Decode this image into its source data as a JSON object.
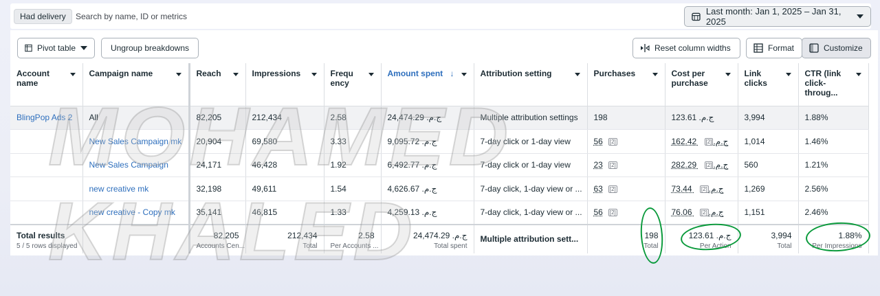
{
  "toolbar_top": {
    "filter_chip": "Had delivery",
    "search_placeholder": "Search by name, ID or metrics",
    "date_range": "Last month: Jan 1, 2025 – Jan 31, 2025"
  },
  "toolbar": {
    "pivot": "Pivot table",
    "ungroup": "Ungroup breakdowns",
    "reset": "Reset column widths",
    "format": "Format",
    "customize": "Customize"
  },
  "columns": [
    "Account name",
    "Campaign name",
    "Reach",
    "Impressions",
    "Frequ ency",
    "Amount spent",
    "Attribution setting",
    "Purchases",
    "Cost per purchase",
    "Link clicks",
    "CTR (link click-throug..."
  ],
  "rows": [
    {
      "account": "BlingPop Ads 2",
      "campaign": "All",
      "reach": "82,205",
      "impressions": "212,434",
      "frequency": "2.58",
      "spent": "24,474.29 ج.م.‏",
      "attribution": "Multiple attribution settings",
      "purchases": "198",
      "cost": "123.61 ج.م.‏",
      "clicks": "3,994",
      "ctr": "1.88%"
    },
    {
      "account": "",
      "campaign": "New Sales Campaign mk",
      "reach": "20,904",
      "impressions": "69,580",
      "frequency": "3.33",
      "spent": "9,095.72 ج.م.‏",
      "attribution": "7-day click or 1-day view",
      "purchases": "56",
      "cost": "162.42 ج.م.‏",
      "clicks": "1,014",
      "ctr": "1.46%"
    },
    {
      "account": "",
      "campaign": "New Sales Campaign",
      "reach": "24,171",
      "impressions": "46,428",
      "frequency": "1.92",
      "spent": "6,492.77 ج.م.‏",
      "attribution": "7-day click or 1-day view",
      "purchases": "23",
      "cost": "282.29 ج.م.‏",
      "clicks": "560",
      "ctr": "1.21%"
    },
    {
      "account": "",
      "campaign": "new creative mk",
      "reach": "32,198",
      "impressions": "49,611",
      "frequency": "1.54",
      "spent": "4,626.67 ج.م.‏",
      "attribution": "7-day click, 1-day view or ...",
      "purchases": "63",
      "cost": "73.44 ج.م.‏",
      "clicks": "1,269",
      "ctr": "2.56%"
    },
    {
      "account": "",
      "campaign": "new creative - Copy mk",
      "reach": "35,141",
      "impressions": "46,815",
      "frequency": "1.33",
      "spent": "4,259.13 ج.م.‏",
      "attribution": "7-day click, 1-day view or ...",
      "purchases": "56",
      "cost": "76.06 ج.م.‏",
      "clicks": "1,151",
      "ctr": "2.46%"
    }
  ],
  "sup_label": "[2]",
  "totals": {
    "label": "Total results",
    "sublabel": "5 / 5 rows displayed",
    "reach": "82,205",
    "reach_sub": "Accounts Cen...",
    "impressions": "212,434",
    "impressions_sub": "Total",
    "frequency": "2.58",
    "frequency_sub": "Per Accounts ...",
    "spent": "24,474.29 ج.م.‏",
    "spent_sub": "Total spent",
    "attribution": "Multiple attribution sett...",
    "purchases": "198",
    "purchases_sub": "Total",
    "cost": "123.61 ج.م.‏",
    "cost_sub": "Per Action",
    "clicks": "3,994",
    "clicks_sub": "Total",
    "ctr": "1.88%",
    "ctr_sub": "Per Impressions"
  },
  "watermark": "MOHAMED KHALED",
  "colors": {
    "link": "#2e6fbd",
    "annotation": "#0a9a3b"
  }
}
